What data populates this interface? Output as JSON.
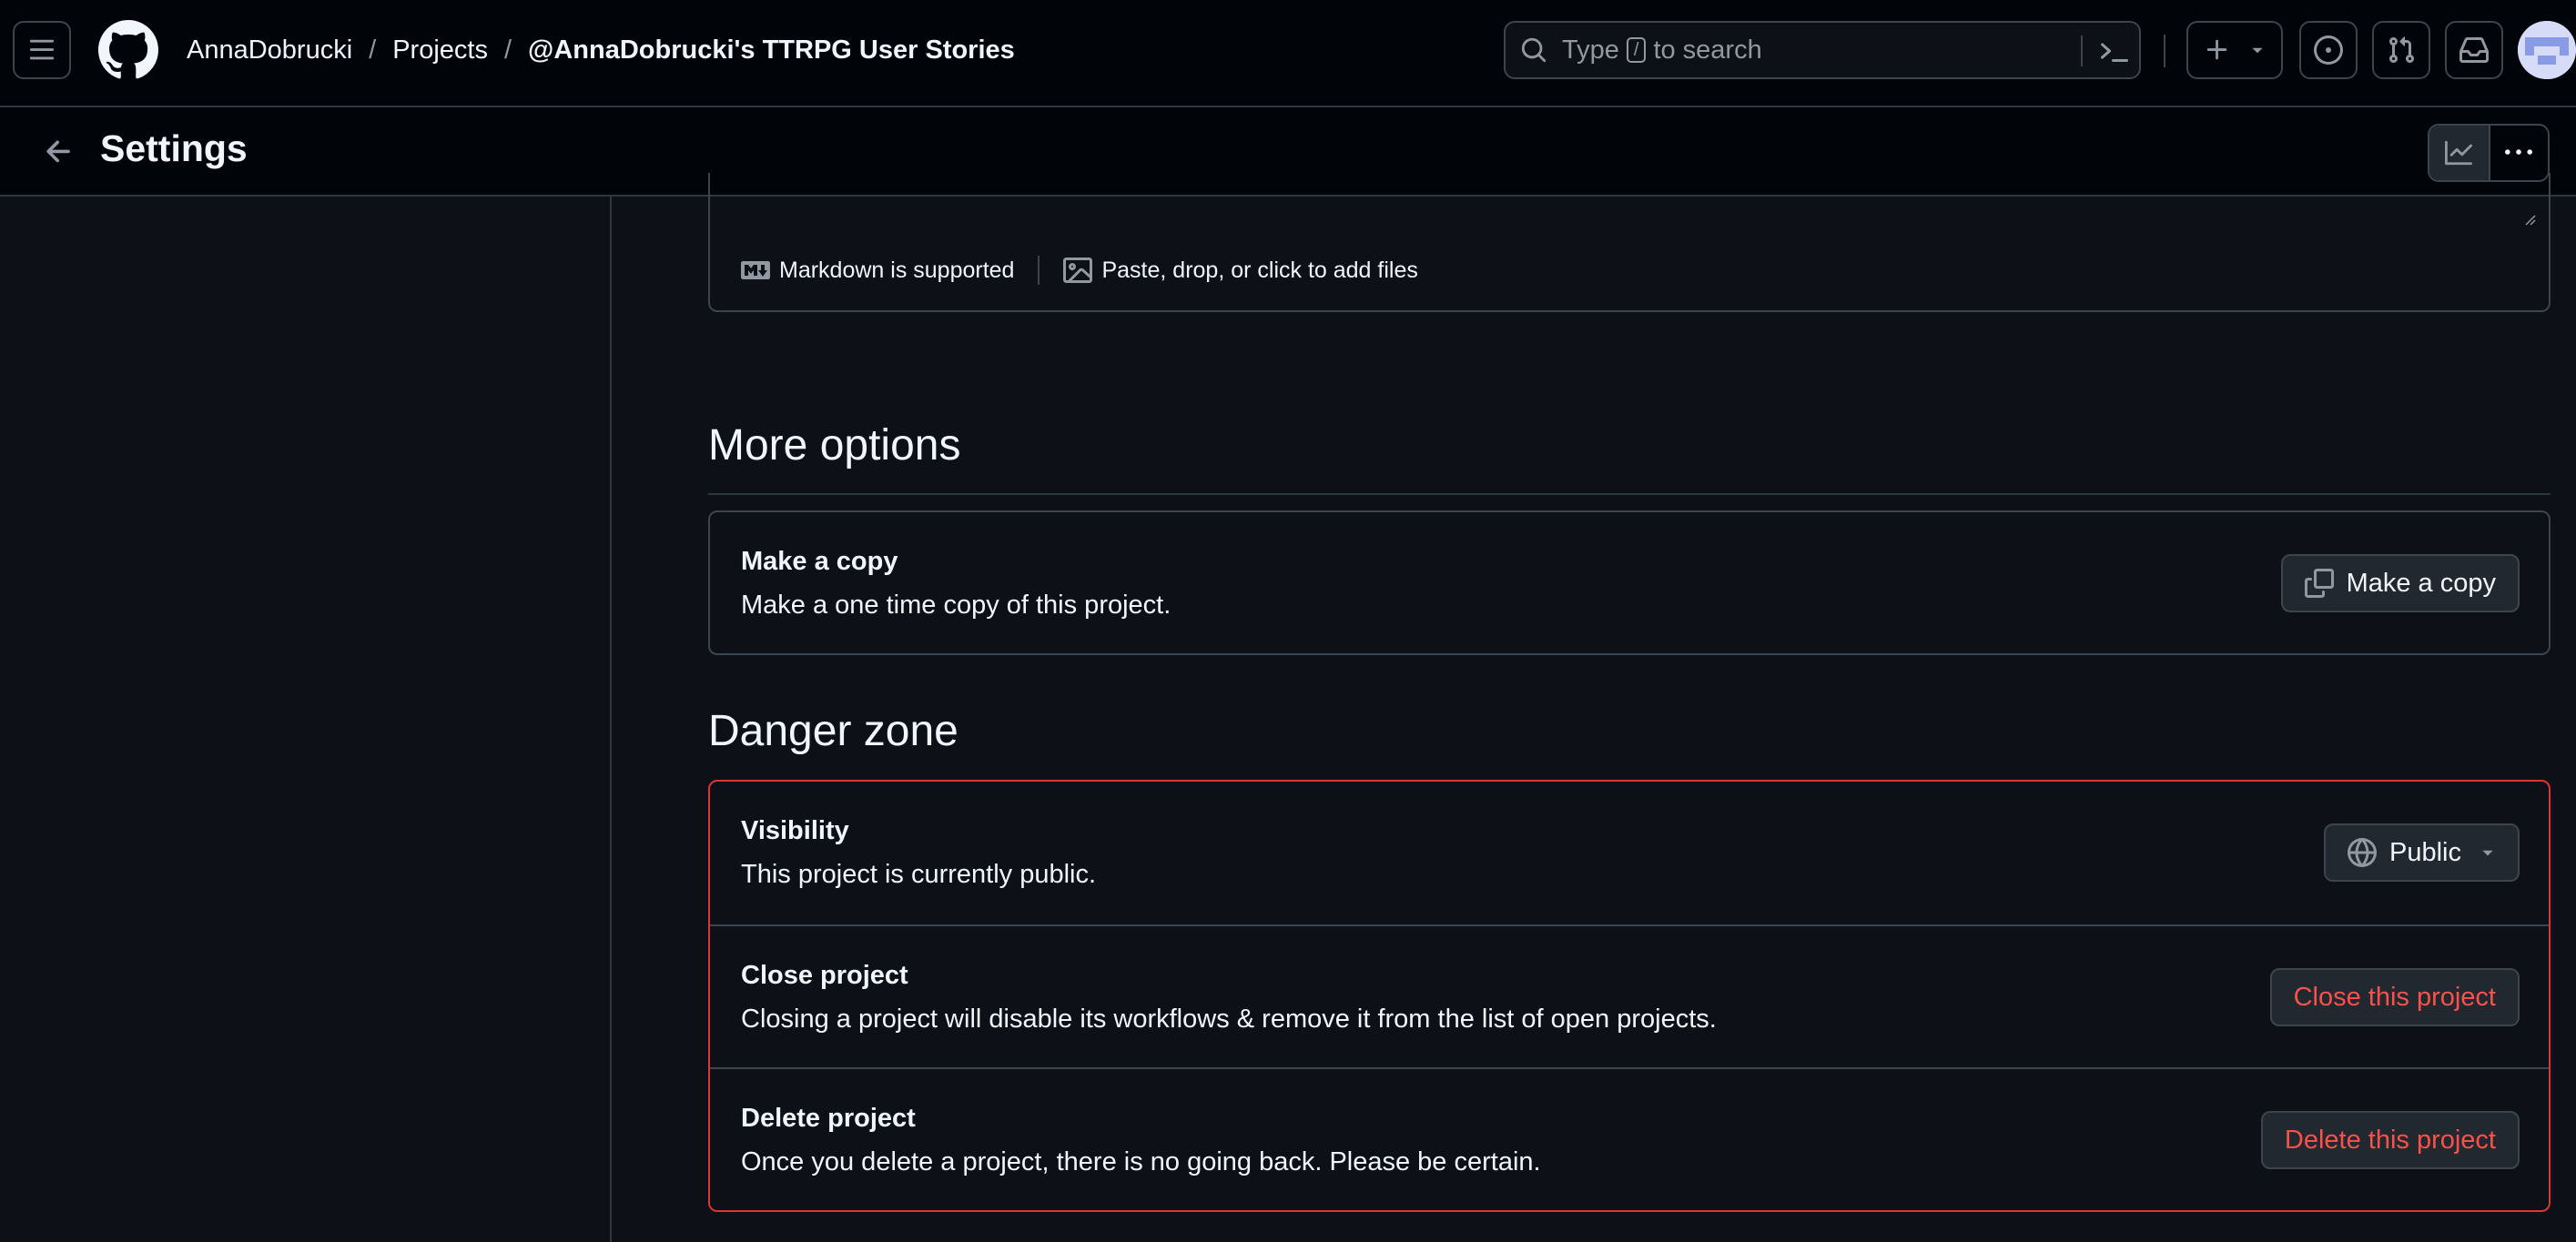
{
  "header": {
    "breadcrumb": {
      "owner": "AnnaDobrucki",
      "section": "Projects",
      "project": "@AnnaDobrucki's TTRPG User Stories",
      "separator": "/"
    },
    "search": {
      "prefix": "Type",
      "key": "/",
      "suffix": "to search"
    }
  },
  "subheader": {
    "title": "Settings"
  },
  "readme_editor": {
    "markdown_note": "Markdown is supported",
    "attach_note": "Paste, drop, or click to add files"
  },
  "more_options": {
    "title": "More options",
    "copy": {
      "title": "Make a copy",
      "description": "Make a one time copy of this project.",
      "button": "Make a copy"
    }
  },
  "danger_zone": {
    "title": "Danger zone",
    "visibility": {
      "title": "Visibility",
      "description": "This project is currently public.",
      "value": "Public"
    },
    "close": {
      "title": "Close project",
      "description": "Closing a project will disable its workflows & remove it from the list of open projects.",
      "button": "Close this project"
    },
    "delete": {
      "title": "Delete project",
      "description": "Once you delete a project, there is no going back. Please be certain.",
      "button": "Delete this project"
    }
  },
  "colors": {
    "background": "#0d1117",
    "header_background": "#010409",
    "border": "#3d444d",
    "danger": "#f85149",
    "danger_border": "#da3633",
    "text": "#f0f6fc",
    "muted_text": "#9198a1"
  }
}
